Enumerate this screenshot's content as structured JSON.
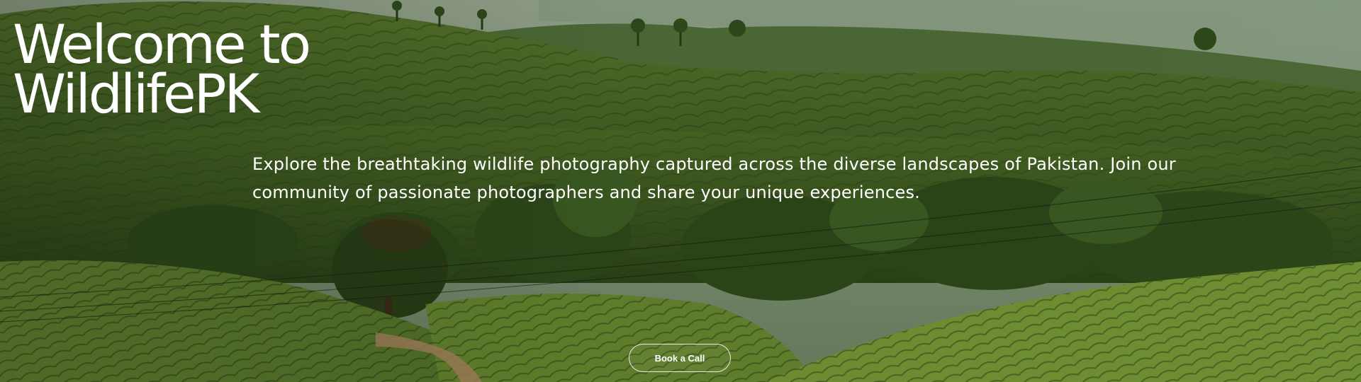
{
  "hero": {
    "title_line1": "Welcome to",
    "title_line2": "WildlifePK",
    "description": "Explore the breathtaking wildlife photography captured across the diverse landscapes of Pakistan. Join our community of passionate photographers and share your unique experiences.",
    "cta_label": "Book a Call"
  },
  "colors": {
    "text": "#ffffff",
    "hill_dark": "#2f4a1c",
    "hill_light": "#6b8a34",
    "mist": "#b9c7b0"
  }
}
